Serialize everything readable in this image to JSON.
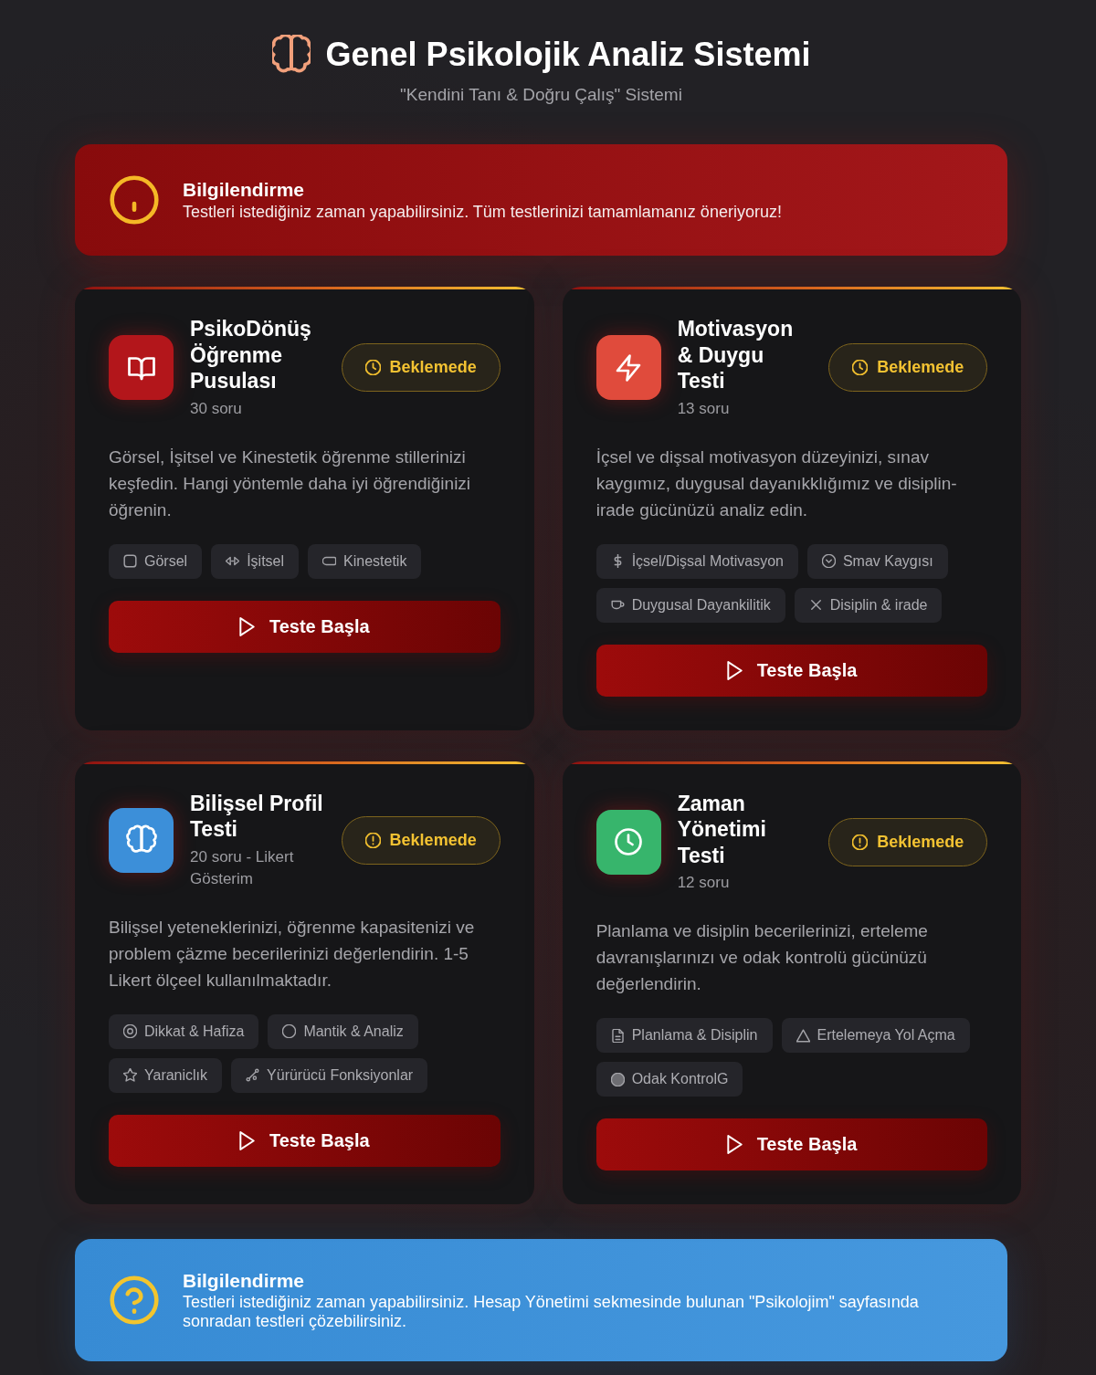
{
  "header": {
    "title": "Genel Psikolojik Analiz Sistemi",
    "subtitle": "\"Kendini Tanı & Doğru Çalış\" Sistemi"
  },
  "notice_top": {
    "kind": "alert",
    "title": "Bilgilendirme",
    "text": "Testleri istediğiniz zaman yapabilirsiniz. Tüm testlerinizi tamamlamanız öneriyoruz!"
  },
  "tests": [
    {
      "title": "PsikoDönüş Öğrenme Pusulası",
      "questions": "30 soru",
      "status": "Beklemede",
      "color": "#b3161b",
      "description": "Görsel, İşitsel ve Kinestetik öğrenme stillerinizi keşfedin. Hangi yöntemle daha iyi öğrendiğinizi öğrenin.",
      "tags": [
        "Görsel",
        "İşitsel",
        "Kinestetik"
      ],
      "button": "Teste Başla"
    },
    {
      "title": "Motivasyon & Duygu Testi",
      "questions": "13 soru",
      "status": "Beklemede",
      "color": "#e04b3c",
      "description": "İçsel ve dişsal motivasyon düzeyinizi, sınav kaygımız, duygusal dayanıkklığımız ve disiplin-irade gücünüzü analiz edin.",
      "tags": [
        "İçsel/Dişsal Motivasyon",
        "Smav Kaygısı",
        "Duygusal Dayankilitik",
        "Disiplin & irade"
      ],
      "button": "Teste Başla"
    },
    {
      "title": "Bilişsel Profil Testi",
      "questions": "20 soru - Likert Gösterim",
      "status": "Beklemede",
      "color": "#3c8fd9",
      "description": "Bilişsel yeteneklerinizi, öğrenme kapasitenizi ve problem çäzme becerilerinizi değerlendirin. 1-5 Likert ölçeel kullanılmaktadır.",
      "tags": [
        "Dikkat & Hafiza",
        "Mantik & Analiz",
        "Yaraniclık",
        "Yürürücü Fonksiyonlar"
      ],
      "button": "Teste Başla"
    },
    {
      "title": "Zaman Yönetimi Testi",
      "questions": "12 soru",
      "status": "Beklemede",
      "color": "#37b56c",
      "description": "Planlama ve disiplin becerilerinizi, erteleme davranışlarınızı ve odak kontrolü gücünüzü değerlendirin.",
      "tags": [
        "Planlama & Disiplin",
        "Ertelemeya Yol Açma",
        "Odak KontrolG"
      ],
      "button": "Teste Başla"
    }
  ],
  "notice_bottom": {
    "kind": "info",
    "title": "Bilgilendirme",
    "text": "Testleri istediğiniz zaman yapabilirsiniz. Hesap Yönetimi sekmesinde bulunan \"Psikolojim\" sayfasında sonradan testleri çözebilirsiniz."
  }
}
